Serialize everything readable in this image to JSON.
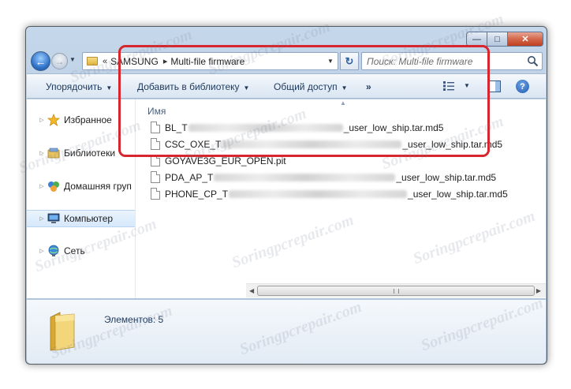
{
  "window": {
    "caption_buttons": {
      "minimize": "—",
      "maximize": "□",
      "close": "✕"
    }
  },
  "nav": {
    "breadcrumb": [
      {
        "label": "SAMSUNG"
      },
      {
        "label": "Multi-file firmware"
      }
    ],
    "crumb_separator": "«",
    "crumb_arrow": "▸",
    "search_placeholder": "Поиск: Multi-file firmware"
  },
  "toolbar": {
    "organize": "Упорядочить",
    "add_to_library": "Добавить в библиотеку",
    "share": "Общий доступ",
    "more": "»"
  },
  "sidebar": {
    "items": [
      {
        "label": "Избранное",
        "icon": "star-icon"
      },
      {
        "label": "Библиотеки",
        "icon": "libraries-icon"
      },
      {
        "label": "Домашняя груп",
        "icon": "homegroup-icon"
      },
      {
        "label": "Компьютер",
        "icon": "computer-icon",
        "selected": true
      },
      {
        "label": "Сеть",
        "icon": "network-icon"
      }
    ]
  },
  "files": {
    "column_name": "Имя",
    "rows": [
      {
        "prefix": "BL_T",
        "suffix": "_user_low_ship.tar.md5",
        "redacted": true
      },
      {
        "prefix": "CSC_OXE_T",
        "suffix": "_user_low_ship.tar.md5",
        "redacted": true
      },
      {
        "prefix": "GOYAVE3G_EUR_OPEN.pit",
        "suffix": "",
        "redacted": false
      },
      {
        "prefix": "PDA_AP_T",
        "suffix": "_user_low_ship.tar.md5",
        "redacted": true
      },
      {
        "prefix": "PHONE_CP_T",
        "suffix": "_user_low_ship.tar.md5",
        "redacted": true
      }
    ]
  },
  "status": {
    "items_count": "Элементов: 5"
  },
  "watermark": "Soringpcrepair.com",
  "colors": {
    "highlight": "#d7262e",
    "accent": "#1e5ab0"
  }
}
